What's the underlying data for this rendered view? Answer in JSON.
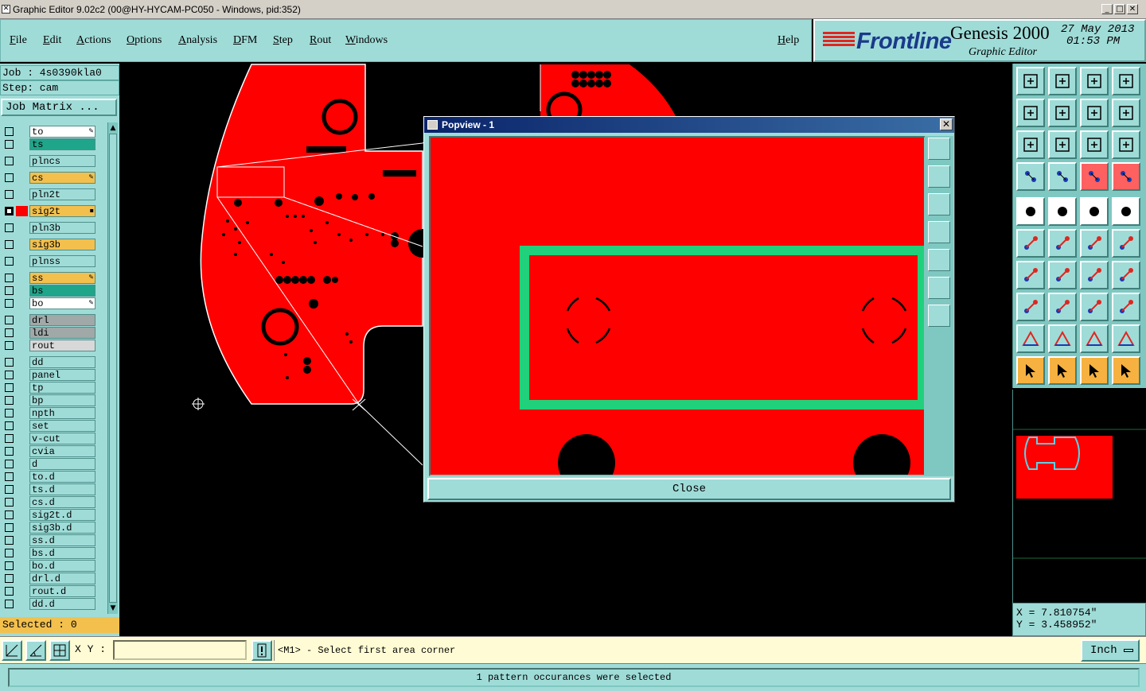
{
  "window": {
    "title": "Graphic Editor 9.02c2 (00@HY-HYCAM-PC050 - Windows, pid:352)",
    "controls": [
      "_",
      "□",
      "✕"
    ]
  },
  "menu": {
    "items": [
      "File",
      "Edit",
      "Actions",
      "Options",
      "Analysis",
      "DFM",
      "Step",
      "Rout",
      "Windows"
    ],
    "help": "Help"
  },
  "brand": {
    "logo": "Frontline",
    "product": "Genesis 2000",
    "subtitle": "Graphic Editor",
    "date": "27 May 2013",
    "time": "01:53 PM",
    "logo_color": "#1a3a8a",
    "stripe_color": "#e0261f"
  },
  "job": {
    "job_line": "Job : 4s0390kla0",
    "step_line": "Step: cam",
    "matrix_button": "Job Matrix ..."
  },
  "layers": [
    {
      "name": "to",
      "bg": "#ffffff",
      "checked": false,
      "mark": "✎",
      "color": ""
    },
    {
      "name": "ts",
      "bg": "#1fa58a",
      "checked": false,
      "mark": "",
      "color": ""
    },
    {
      "name": "plncs",
      "bg": "#9fdcd8",
      "checked": false,
      "mark": "",
      "color": ""
    },
    {
      "name": "cs",
      "bg": "#f3c04d",
      "checked": false,
      "mark": "✎",
      "color": ""
    },
    {
      "name": "pln2t",
      "bg": "#9fdcd8",
      "checked": false,
      "mark": "",
      "color": ""
    },
    {
      "name": "sig2t",
      "bg": "#f3c04d",
      "checked": true,
      "mark": "▪",
      "color": "#ff0000"
    },
    {
      "name": "pln3b",
      "bg": "#9fdcd8",
      "checked": false,
      "mark": "",
      "color": ""
    },
    {
      "name": "sig3b",
      "bg": "#f3c04d",
      "checked": false,
      "mark": "",
      "color": ""
    },
    {
      "name": "plnss",
      "bg": "#9fdcd8",
      "checked": false,
      "mark": "",
      "color": ""
    },
    {
      "name": "ss",
      "bg": "#f3c04d",
      "checked": false,
      "mark": "✎",
      "color": ""
    },
    {
      "name": "bs",
      "bg": "#1fa58a",
      "checked": false,
      "mark": "",
      "color": ""
    },
    {
      "name": "bo",
      "bg": "#ffffff",
      "checked": false,
      "mark": "✎",
      "color": ""
    },
    {
      "name": "drl",
      "bg": "#a0a8a8",
      "checked": false,
      "mark": "",
      "color": ""
    },
    {
      "name": "ldi",
      "bg": "#a0a8a8",
      "checked": false,
      "mark": "",
      "color": ""
    },
    {
      "name": "rout",
      "bg": "#d8d8d8",
      "checked": false,
      "mark": "",
      "color": ""
    },
    {
      "name": "dd",
      "bg": "#9fdcd8",
      "checked": false,
      "mark": "",
      "color": ""
    },
    {
      "name": "panel",
      "bg": "#9fdcd8",
      "checked": false,
      "mark": "",
      "color": ""
    },
    {
      "name": "tp",
      "bg": "#9fdcd8",
      "checked": false,
      "mark": "",
      "color": ""
    },
    {
      "name": "bp",
      "bg": "#9fdcd8",
      "checked": false,
      "mark": "",
      "color": ""
    },
    {
      "name": "npth",
      "bg": "#9fdcd8",
      "checked": false,
      "mark": "",
      "color": ""
    },
    {
      "name": "set",
      "bg": "#9fdcd8",
      "checked": false,
      "mark": "",
      "color": ""
    },
    {
      "name": "v-cut",
      "bg": "#9fdcd8",
      "checked": false,
      "mark": "",
      "color": ""
    },
    {
      "name": "cvia",
      "bg": "#9fdcd8",
      "checked": false,
      "mark": "",
      "color": ""
    },
    {
      "name": "d",
      "bg": "#9fdcd8",
      "checked": false,
      "mark": "",
      "color": ""
    },
    {
      "name": "to.d",
      "bg": "#9fdcd8",
      "checked": false,
      "mark": "",
      "color": ""
    },
    {
      "name": "ts.d",
      "bg": "#9fdcd8",
      "checked": false,
      "mark": "",
      "color": ""
    },
    {
      "name": "cs.d",
      "bg": "#9fdcd8",
      "checked": false,
      "mark": "",
      "color": ""
    },
    {
      "name": "sig2t.d",
      "bg": "#9fdcd8",
      "checked": false,
      "mark": "",
      "color": ""
    },
    {
      "name": "sig3b.d",
      "bg": "#9fdcd8",
      "checked": false,
      "mark": "",
      "color": ""
    },
    {
      "name": "ss.d",
      "bg": "#9fdcd8",
      "checked": false,
      "mark": "",
      "color": ""
    },
    {
      "name": "bs.d",
      "bg": "#9fdcd8",
      "checked": false,
      "mark": "",
      "color": ""
    },
    {
      "name": "bo.d",
      "bg": "#9fdcd8",
      "checked": false,
      "mark": "",
      "color": ""
    },
    {
      "name": "drl.d",
      "bg": "#9fdcd8",
      "checked": false,
      "mark": "",
      "color": ""
    },
    {
      "name": "rout.d",
      "bg": "#9fdcd8",
      "checked": false,
      "mark": "",
      "color": ""
    },
    {
      "name": "dd.d",
      "bg": "#9fdcd8",
      "checked": false,
      "mark": "",
      "color": ""
    }
  ],
  "selected": "Selected : 0",
  "popview": {
    "title": "Popview - 1",
    "close_button": "Close",
    "accent_green": "#21d07a"
  },
  "coords": {
    "x": "X = 7.810754\"",
    "y": "Y = 3.458952\""
  },
  "bottom": {
    "xy_label": "X Y :",
    "xy_value": "",
    "prompt": "<M1> - Select first area corner",
    "units": "Inch"
  },
  "status": "1 pattern occurances were selected",
  "colors": {
    "board_red": "#ff0000",
    "panel_teal": "#9fdcd8",
    "highlight_orange": "#f3c04d"
  }
}
